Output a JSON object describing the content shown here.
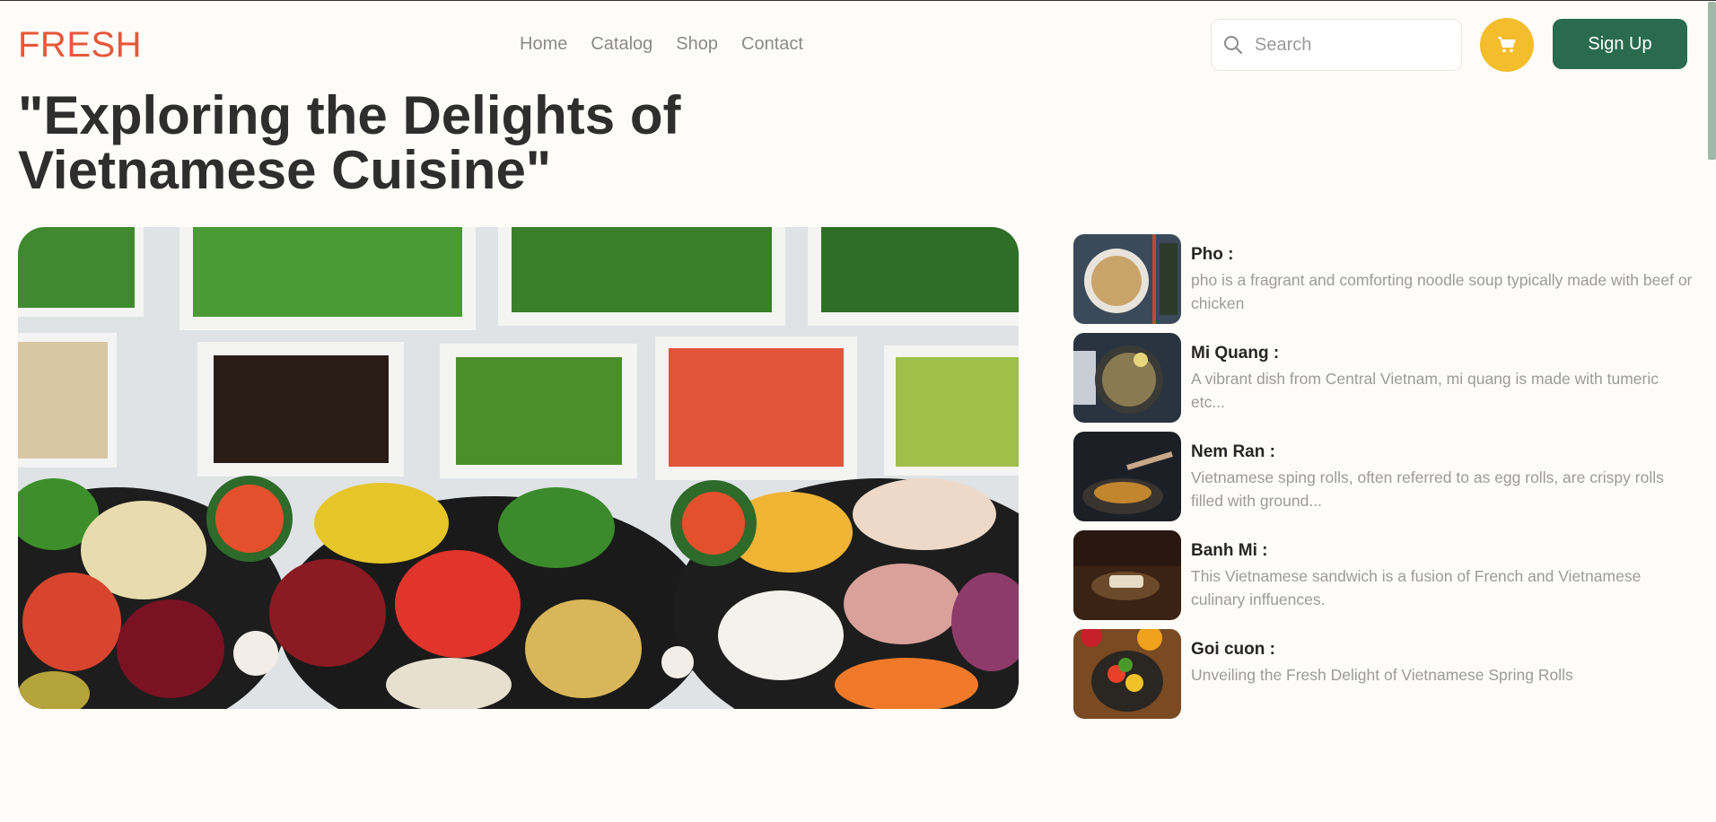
{
  "brand": {
    "logo": "FRESH"
  },
  "nav": {
    "items": [
      "Home",
      "Catalog",
      "Shop",
      "Contact"
    ]
  },
  "header": {
    "search_placeholder": "Search",
    "search_value": "",
    "cart_icon": "cart-icon",
    "signup_label": "Sign Up",
    "accent_color": "#e8573b",
    "cart_color": "#f3bd2c",
    "signup_color": "#2a6b50"
  },
  "main": {
    "title_line1": "\"Exploring the Delights of",
    "title_line2": "Vietnamese Cuisine\"",
    "hero_image": "salad-bar-photo"
  },
  "dishes": [
    {
      "name": "Pho :",
      "description": "pho is a fragrant and comforting noodle soup typically made with beef or chicken",
      "image": "pho-photo"
    },
    {
      "name": "Mi Quang :",
      "description": "A vibrant dish from Central Vietnam, mi quang is made with tumeric etc...",
      "image": "mi-quang-photo"
    },
    {
      "name": "Nem Ran :",
      "description": "Vietnamese sping rolls, often referred to as egg rolls, are crispy rolls filled with ground...",
      "image": "nem-ran-photo"
    },
    {
      "name": "Banh Mi :",
      "description": "This Vietnamese sandwich is a fusion of French and Vietnamese culinary inffuences.",
      "image": "banh-mi-photo"
    },
    {
      "name": "Goi cuon :",
      "description": "Unveiling the Fresh Delight of Vietnamese Spring Rolls",
      "image": "goi-cuon-photo"
    }
  ]
}
